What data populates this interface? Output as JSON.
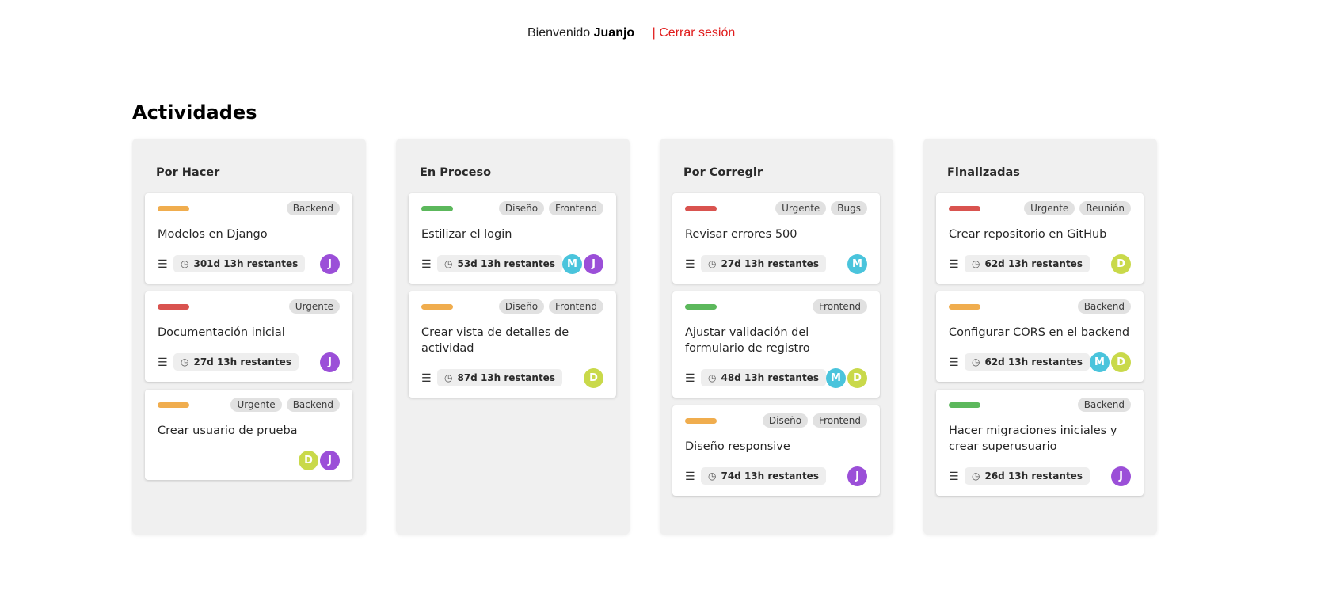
{
  "header": {
    "welcome_prefix": "Bienvenido",
    "user_name": "Juanjo",
    "logout_label": "| Cerrar sesión"
  },
  "page_title": "Actividades",
  "colors": {
    "priority": {
      "orange": "#f0ad4e",
      "red": "#d9534f",
      "green": "#5cb85c"
    },
    "avatars": {
      "J": "#9b4fd8",
      "M": "#4ac4dc",
      "D": "#c9d94a"
    }
  },
  "columns": [
    {
      "title": "Por Hacer",
      "cards": [
        {
          "priority": "orange",
          "tags": [
            "Backend"
          ],
          "title": "Modelos en Django",
          "time": "301d 13h restantes",
          "avatars": [
            "J"
          ]
        },
        {
          "priority": "red",
          "tags": [
            "Urgente"
          ],
          "title": "Documentación inicial",
          "time": "27d 13h restantes",
          "avatars": [
            "J"
          ]
        },
        {
          "priority": "orange",
          "tags": [
            "Urgente",
            "Backend"
          ],
          "title": "Crear usuario de prueba",
          "time": "",
          "avatars": [
            "D",
            "J"
          ]
        }
      ]
    },
    {
      "title": "En Proceso",
      "cards": [
        {
          "priority": "green",
          "tags": [
            "Diseño",
            "Frontend"
          ],
          "title": "Estilizar el login",
          "time": "53d 13h restantes",
          "avatars": [
            "M",
            "J"
          ]
        },
        {
          "priority": "orange",
          "tags": [
            "Diseño",
            "Frontend"
          ],
          "title": "Crear vista de detalles de actividad",
          "time": "87d 13h restantes",
          "avatars": [
            "D"
          ]
        }
      ]
    },
    {
      "title": "Por Corregir",
      "cards": [
        {
          "priority": "red",
          "tags": [
            "Urgente",
            "Bugs"
          ],
          "title": "Revisar errores 500",
          "time": "27d 13h restantes",
          "avatars": [
            "M"
          ]
        },
        {
          "priority": "green",
          "tags": [
            "Frontend"
          ],
          "title": "Ajustar validación del formulario de registro",
          "time": "48d 13h restantes",
          "avatars": [
            "M",
            "D"
          ]
        },
        {
          "priority": "orange",
          "tags": [
            "Diseño",
            "Frontend"
          ],
          "title": "Diseño responsive",
          "time": "74d 13h restantes",
          "avatars": [
            "J"
          ]
        }
      ]
    },
    {
      "title": "Finalizadas",
      "cards": [
        {
          "priority": "red",
          "tags": [
            "Urgente",
            "Reunión"
          ],
          "title": "Crear repositorio en GitHub",
          "time": "62d 13h restantes",
          "avatars": [
            "D"
          ]
        },
        {
          "priority": "orange",
          "tags": [
            "Backend"
          ],
          "title": "Configurar CORS en el backend",
          "time": "62d 13h restantes",
          "avatars": [
            "M",
            "D"
          ]
        },
        {
          "priority": "green",
          "tags": [
            "Backend"
          ],
          "title": "Hacer migraciones iniciales y crear superusuario",
          "time": "26d 13h restantes",
          "avatars": [
            "J"
          ]
        }
      ]
    }
  ]
}
